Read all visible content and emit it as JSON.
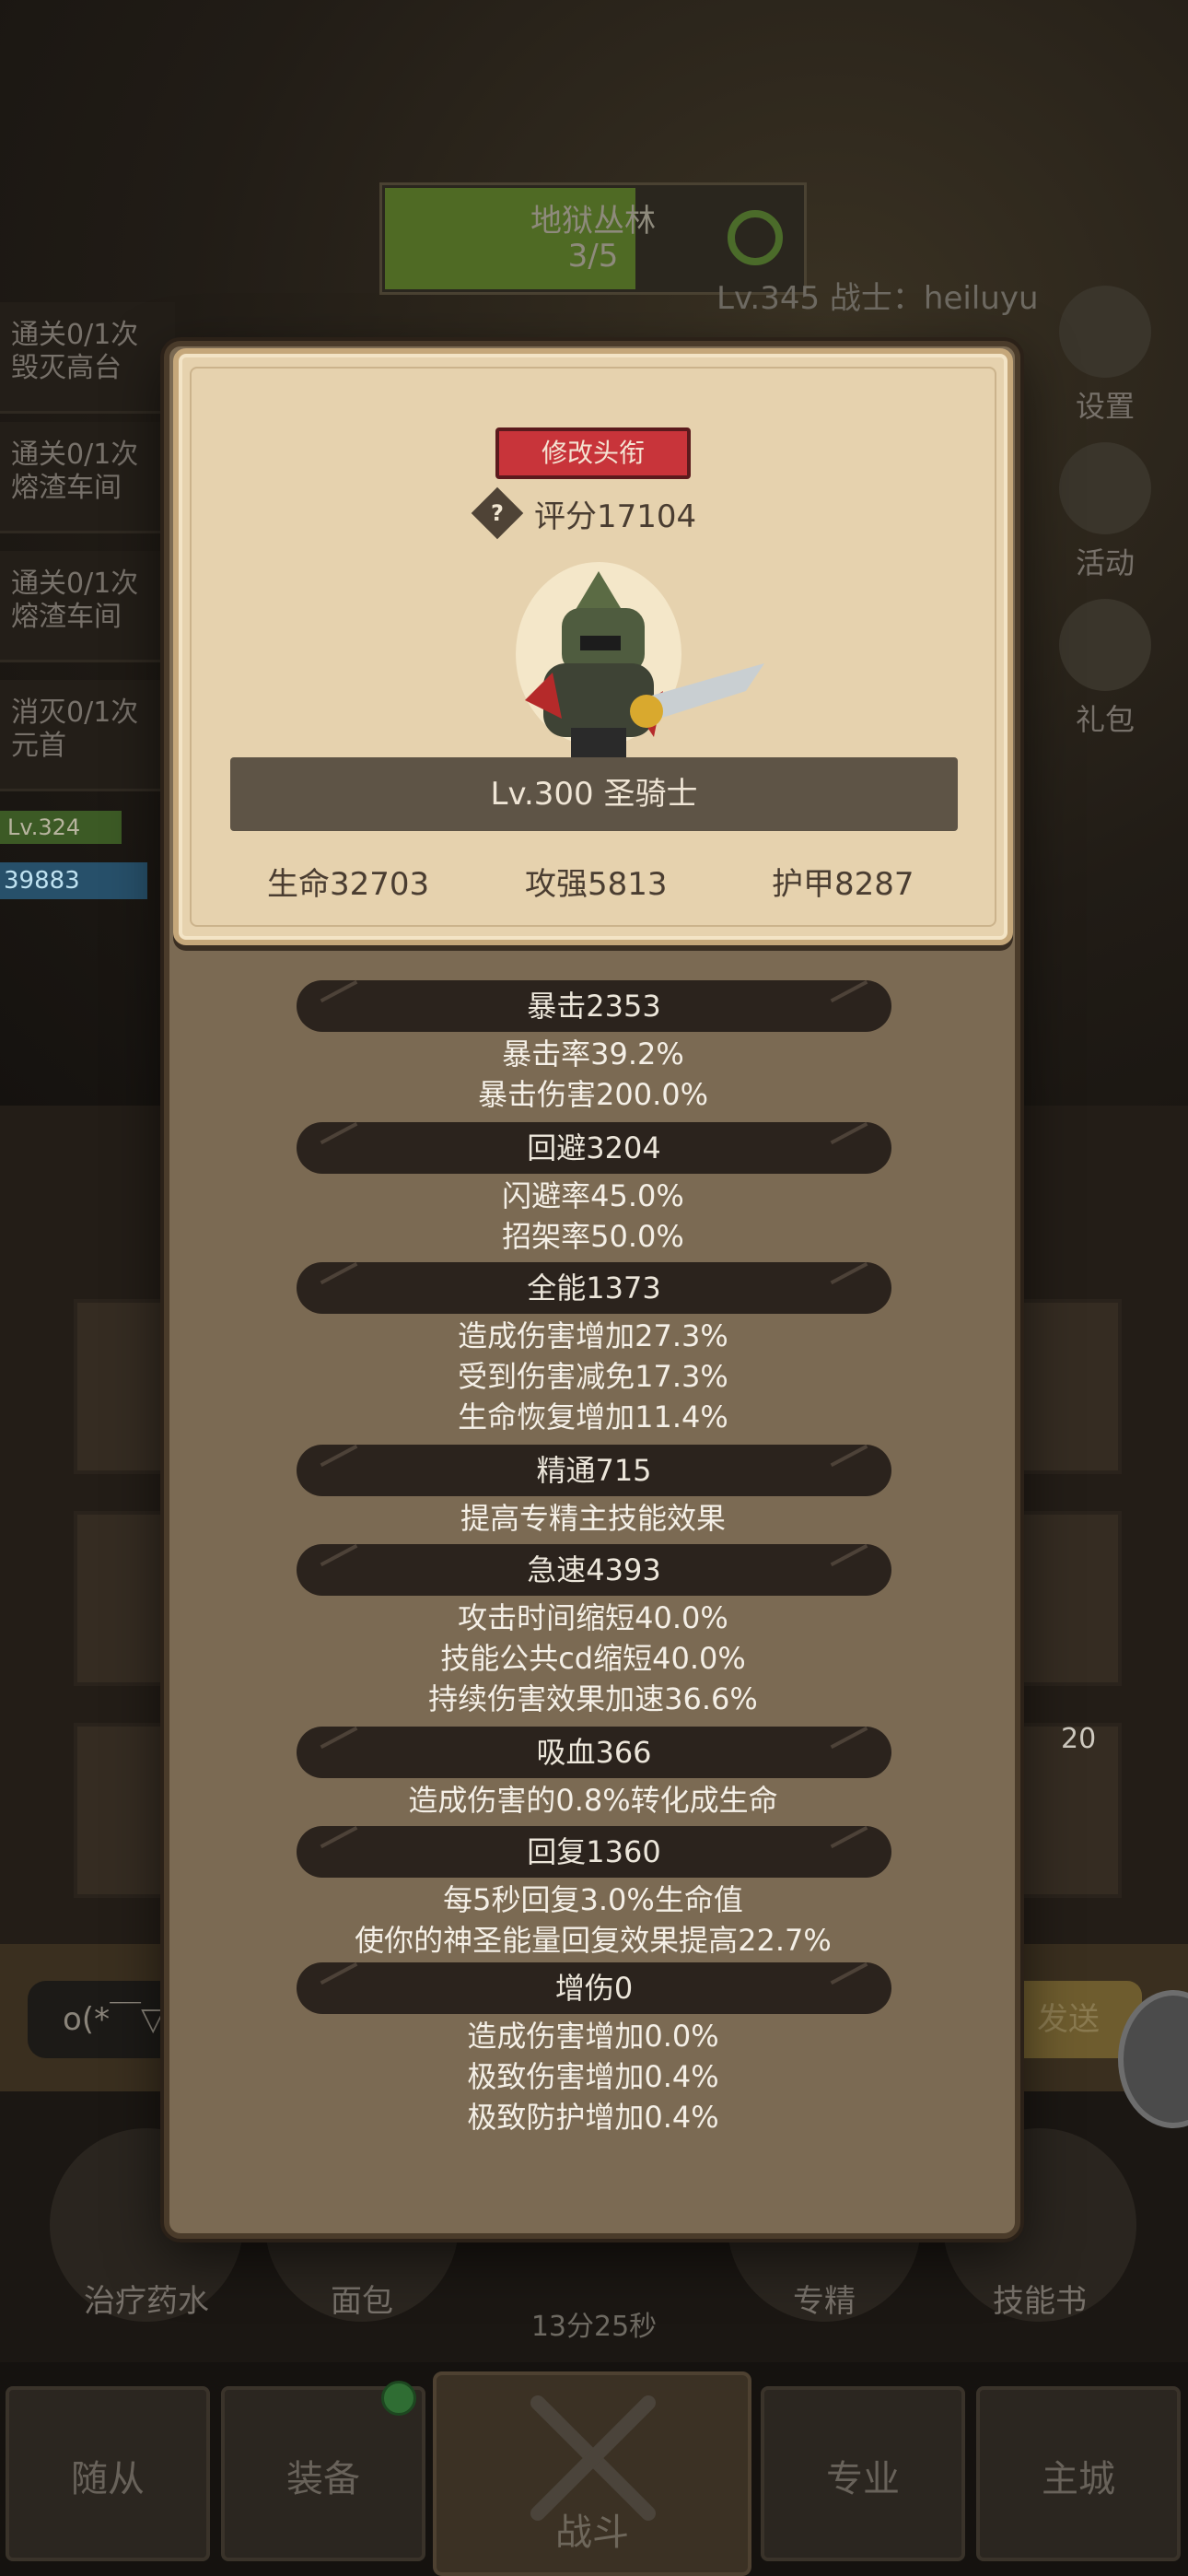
{
  "header": {
    "zone_name": "地狱丛林",
    "zone_progress": "3/5",
    "player_line": "Lv.345 战士：heiluyu"
  },
  "quests": [
    {
      "text": "通关0/1次毁灭高台"
    },
    {
      "text": "通关0/1次熔渣车间"
    },
    {
      "text": "通关0/1次熔渣车间"
    },
    {
      "text": "消灭0/1次元首"
    }
  ],
  "quest_bars": {
    "bar1": "Lv.324",
    "bar2": "39883"
  },
  "side_menu": [
    {
      "label": "设置",
      "icon": "gear-icon"
    },
    {
      "label": "活动",
      "icon": "calendar-icon"
    },
    {
      "label": "礼包",
      "icon": "gift-icon"
    }
  ],
  "slot_badge": "20",
  "chat": {
    "input": "o(*￣▽",
    "send_label": "发送"
  },
  "items": [
    {
      "label": "治疗药水"
    },
    {
      "label": "面包"
    },
    {
      "label": "专精"
    },
    {
      "label": "技能书"
    }
  ],
  "timer": "13分25秒",
  "nav": {
    "tabs": [
      "随从",
      "装备",
      "专业",
      "主城"
    ],
    "center": "战斗"
  },
  "card": {
    "title_button": "修改头衔",
    "score": "评分17104",
    "class_line": "Lv.300 圣骑士",
    "hp": "生命32703",
    "attack": "攻强5813",
    "armor": "护甲8287"
  },
  "sections": [
    {
      "title": "暴击2353",
      "lines": [
        "暴击率39.2%",
        "暴击伤害200.0%"
      ]
    },
    {
      "title": "回避3204",
      "lines": [
        "闪避率45.0%",
        "招架率50.0%"
      ]
    },
    {
      "title": "全能1373",
      "lines": [
        "造成伤害增加27.3%",
        "受到伤害减免17.3%",
        "生命恢复增加11.4%"
      ]
    },
    {
      "title": "精通715",
      "lines": [
        "提高专精主技能效果"
      ]
    },
    {
      "title": "急速4393",
      "lines": [
        "攻击时间缩短40.0%",
        "技能公共cd缩短40.0%",
        "持续伤害效果加速36.6%"
      ]
    },
    {
      "title": "吸血366",
      "lines": [
        "造成伤害的0.8%转化成生命"
      ]
    },
    {
      "title": "回复1360",
      "lines": [
        "每5秒回复3.0%生命值",
        "使你的神圣能量回复效果提高22.7%"
      ]
    },
    {
      "title": "增伤0",
      "lines": [
        "造成伤害增加0.0%",
        "极致伤害增加0.4%",
        "极致防护增加0.4%"
      ]
    }
  ]
}
